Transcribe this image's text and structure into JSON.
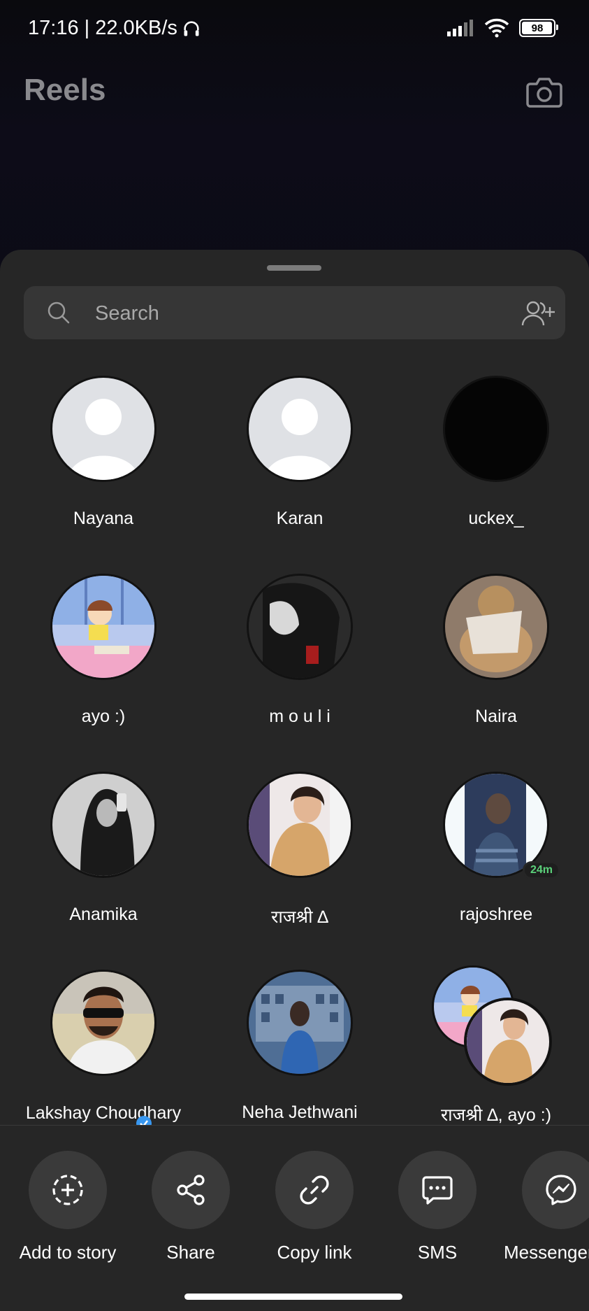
{
  "status_bar": {
    "time_speed": "17:16 | 22.0KB/s",
    "battery": "98",
    "battery_level": 0.98
  },
  "header": {
    "title": "Reels",
    "icon": "camera-icon"
  },
  "share_sheet": {
    "search": {
      "placeholder": "Search",
      "value": ""
    },
    "contacts": [
      {
        "name": "Nayana",
        "avatar": "default-avatar"
      },
      {
        "name": "Karan",
        "avatar": "default-avatar"
      },
      {
        "name": "uckex_",
        "avatar": "black-avatar"
      },
      {
        "name": "ayo :)",
        "avatar": "cartoon-girl-avatar"
      },
      {
        "name": "m o u l i",
        "avatar": "anime-avatar"
      },
      {
        "name": "Naira",
        "avatar": "teddy-bear-avatar"
      },
      {
        "name": "Anamika",
        "avatar": "mirror-selfie-avatar"
      },
      {
        "name": "राजश्री ∆",
        "avatar": "photo-avatar"
      },
      {
        "name": "rajoshree",
        "avatar": "photo-avatar",
        "badge": "24m"
      },
      {
        "name": "Lakshay Choudhary",
        "avatar": "photo-avatar",
        "verified": true
      },
      {
        "name": "Neha Jethwani",
        "avatar": "photo-avatar"
      },
      {
        "name": "राजश्री ∆, ayo :)",
        "avatar": "group-avatar"
      }
    ],
    "actions": [
      {
        "label": "Add to story",
        "icon": "add-story-icon"
      },
      {
        "label": "Share",
        "icon": "share-icon"
      },
      {
        "label": "Copy link",
        "icon": "link-icon"
      },
      {
        "label": "SMS",
        "icon": "sms-icon"
      },
      {
        "label": "Messenger",
        "icon": "messenger-icon"
      }
    ]
  }
}
